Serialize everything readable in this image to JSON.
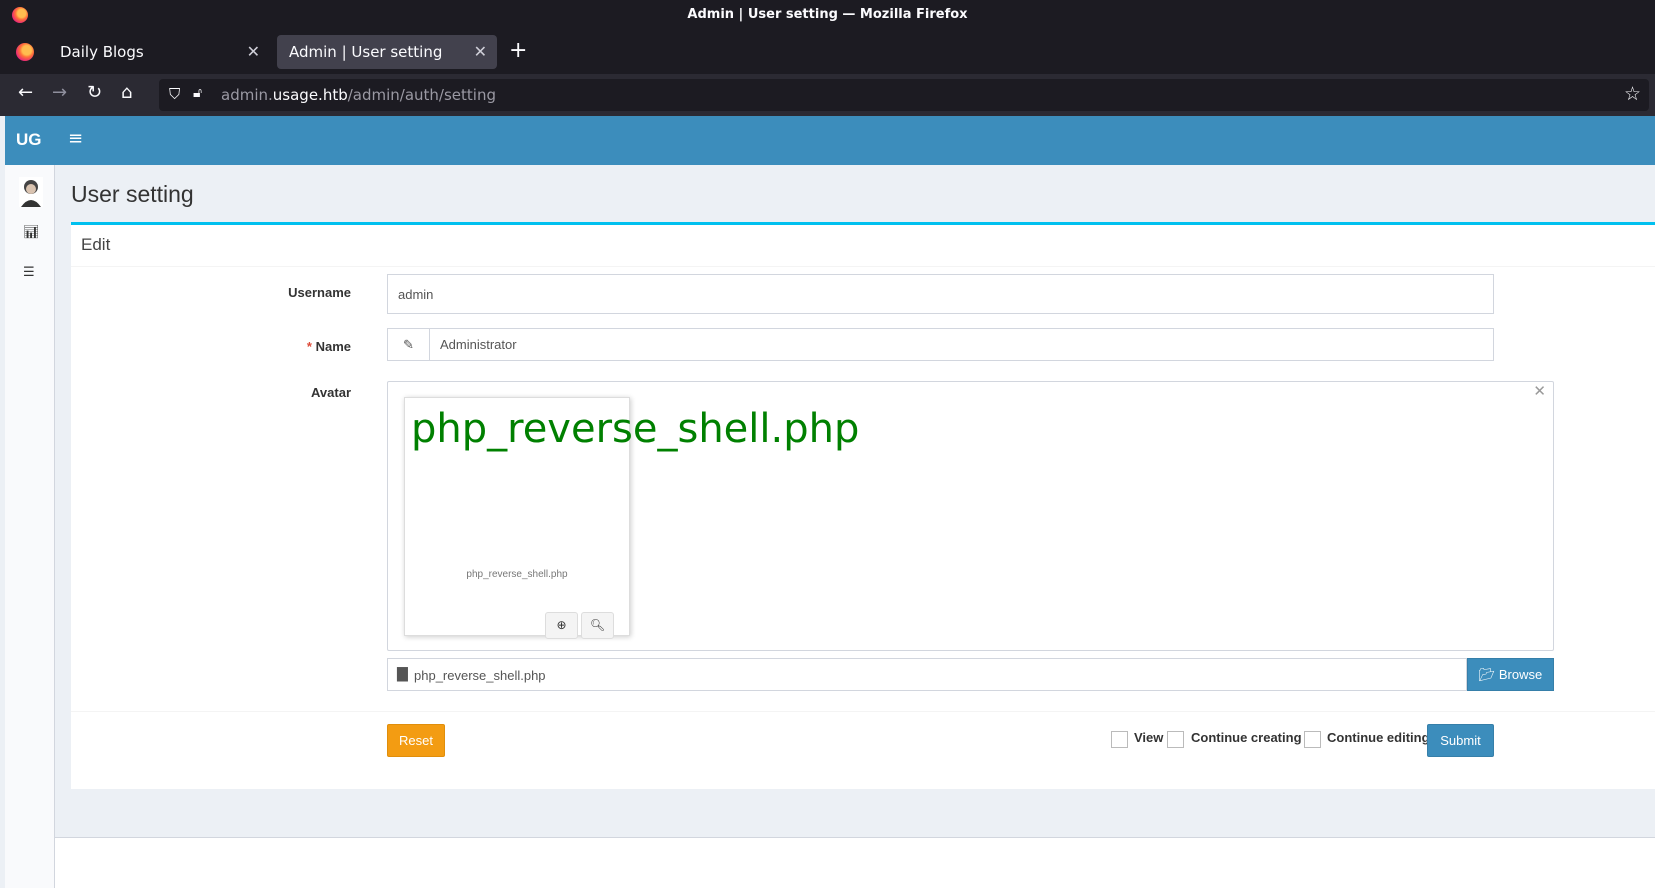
{
  "window": {
    "title": "Admin | User setting — Mozilla Firefox"
  },
  "tabs": [
    {
      "label": "Daily Blogs",
      "active": false
    },
    {
      "label": "Admin | User setting",
      "active": true
    }
  ],
  "urlbar": {
    "url_host_prefix": "admin.",
    "url_host": "usage.htb",
    "url_path": "/admin/auth/setting"
  },
  "app": {
    "logo": "UG",
    "page_title": "User setting",
    "box_title": "Edit",
    "colors": {
      "header": "#3c8dbc",
      "box_border": "#00c0ef",
      "reset": "#f39c12",
      "submit": "#3c8dbc",
      "preview_text": "#008000"
    }
  },
  "form": {
    "username": {
      "label": "Username",
      "value": "admin"
    },
    "name": {
      "required_mark": "*",
      "label": "Name",
      "value": "Administrator"
    },
    "avatar": {
      "label": "Avatar",
      "preview_text": "php_reverse_shell.php",
      "caption": "php_reverse_shell.php",
      "file_name": "php_reverse_shell.php",
      "browse_label": "Browse"
    }
  },
  "footer_actions": {
    "reset": "Reset",
    "checkboxes": [
      {
        "label": "View",
        "checked": false
      },
      {
        "label": "Continue creating",
        "checked": false
      },
      {
        "label": "Continue editing",
        "checked": false
      }
    ],
    "submit": "Submit"
  }
}
